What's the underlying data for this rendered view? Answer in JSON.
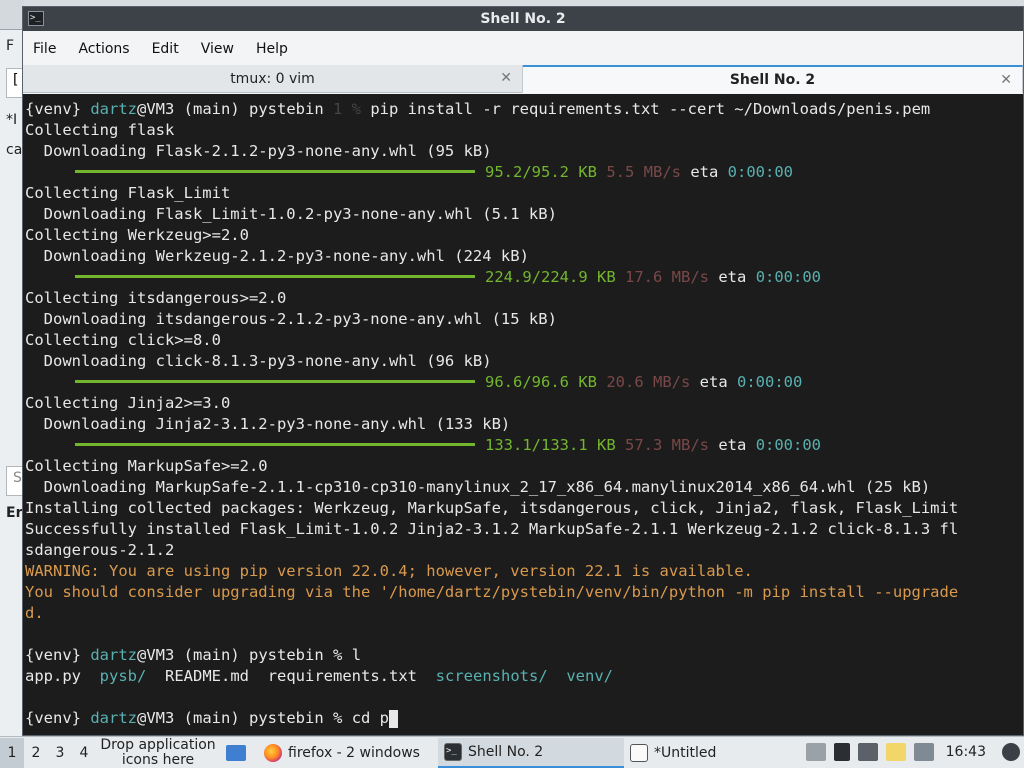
{
  "window": {
    "title": "Shell No. 2",
    "icon": "terminal-icon"
  },
  "menu": [
    "File",
    "Actions",
    "Edit",
    "View",
    "Help"
  ],
  "tabs": [
    {
      "label": "tmux: 0 vim",
      "active": false
    },
    {
      "label": "Shell No. 2",
      "active": true
    }
  ],
  "background_window": {
    "fragments": [
      "F",
      "[",
      "*I",
      "ca",
      "S",
      "Er"
    ]
  },
  "terminal": {
    "prompt": {
      "venv": "{venv}",
      "user": "dartz",
      "host": "@VM3 (main) pystebin",
      "status": "1 %",
      "status2": "%"
    },
    "command1": "pip install -r requirements.txt --cert ~/Downloads/penis.pem",
    "lines": [
      {
        "text": "Collecting flask"
      },
      {
        "text": "  Downloading Flask-2.1.2-py3-none-any.whl (95 kB)"
      },
      {
        "progress": {
          "done": "95.2/95.2 KB",
          "speed": "5.5 MB/s",
          "eta_label": "eta",
          "eta": "0:00:00"
        }
      },
      {
        "text": "Collecting Flask_Limit"
      },
      {
        "text": "  Downloading Flask_Limit-1.0.2-py3-none-any.whl (5.1 kB)"
      },
      {
        "text": "Collecting Werkzeug>=2.0"
      },
      {
        "text": "  Downloading Werkzeug-2.1.2-py3-none-any.whl (224 kB)"
      },
      {
        "progress": {
          "done": "224.9/224.9 KB",
          "speed": "17.6 MB/s",
          "eta_label": "eta",
          "eta": "0:00:00"
        }
      },
      {
        "text": "Collecting itsdangerous>=2.0"
      },
      {
        "text": "  Downloading itsdangerous-2.1.2-py3-none-any.whl (15 kB)"
      },
      {
        "text": "Collecting click>=8.0"
      },
      {
        "text": "  Downloading click-8.1.3-py3-none-any.whl (96 kB)"
      },
      {
        "progress": {
          "done": "96.6/96.6 KB",
          "speed": "20.6 MB/s",
          "eta_label": "eta",
          "eta": "0:00:00"
        }
      },
      {
        "text": "Collecting Jinja2>=3.0"
      },
      {
        "text": "  Downloading Jinja2-3.1.2-py3-none-any.whl (133 kB)"
      },
      {
        "progress": {
          "done": "133.1/133.1 KB",
          "speed": "57.3 MB/s",
          "eta_label": "eta",
          "eta": "0:00:00"
        }
      },
      {
        "text": "Collecting MarkupSafe>=2.0"
      },
      {
        "text": "  Downloading MarkupSafe-2.1.1-cp310-cp310-manylinux_2_17_x86_64.manylinux2014_x86_64.whl (25 kB)"
      },
      {
        "text": "Installing collected packages: Werkzeug, MarkupSafe, itsdangerous, click, Jinja2, flask, Flask_Limit"
      },
      {
        "text": "Successfully installed Flask_Limit-1.0.2 Jinja2-3.1.2 MarkupSafe-2.1.1 Werkzeug-2.1.2 click-8.1.3 fl"
      },
      {
        "text": "sdangerous-2.1.2"
      },
      {
        "warn": "WARNING: You are using pip version 22.0.4; however, version 22.1 is available."
      },
      {
        "warn": "You should consider upgrading via the '/home/dartz/pystebin/venv/bin/python -m pip install --upgrade"
      },
      {
        "warn": "d."
      },
      {
        "text": ""
      }
    ],
    "command2": "l",
    "listing": {
      "files": [
        "app.py",
        "README.md",
        "requirements.txt"
      ],
      "dirs": [
        "pysb/",
        "screenshots/",
        "venv/"
      ]
    },
    "command3": "cd p"
  },
  "taskbar": {
    "workspaces": [
      "1",
      "2",
      "3",
      "4"
    ],
    "drop_hint": "Drop application icons here",
    "tasks": [
      {
        "label": "firefox - 2 windows",
        "icon": "firefox-icon"
      },
      {
        "label": "Shell No. 2",
        "icon": "terminal-icon"
      },
      {
        "label": "*Untitled",
        "icon": "text-editor-icon"
      }
    ],
    "clock": "16:43",
    "tray_icons": [
      "clipboard-icon",
      "volume-icon",
      "network-icon",
      "notes-icon",
      "chat-icon",
      "power-icon"
    ]
  },
  "colors": {
    "terminal_bg": "#1c1c1c",
    "prompt_cyan": "#59b0b0",
    "progress_green": "#73b62e",
    "warning": "#d99a4e",
    "accent": "#3b8fd9"
  }
}
